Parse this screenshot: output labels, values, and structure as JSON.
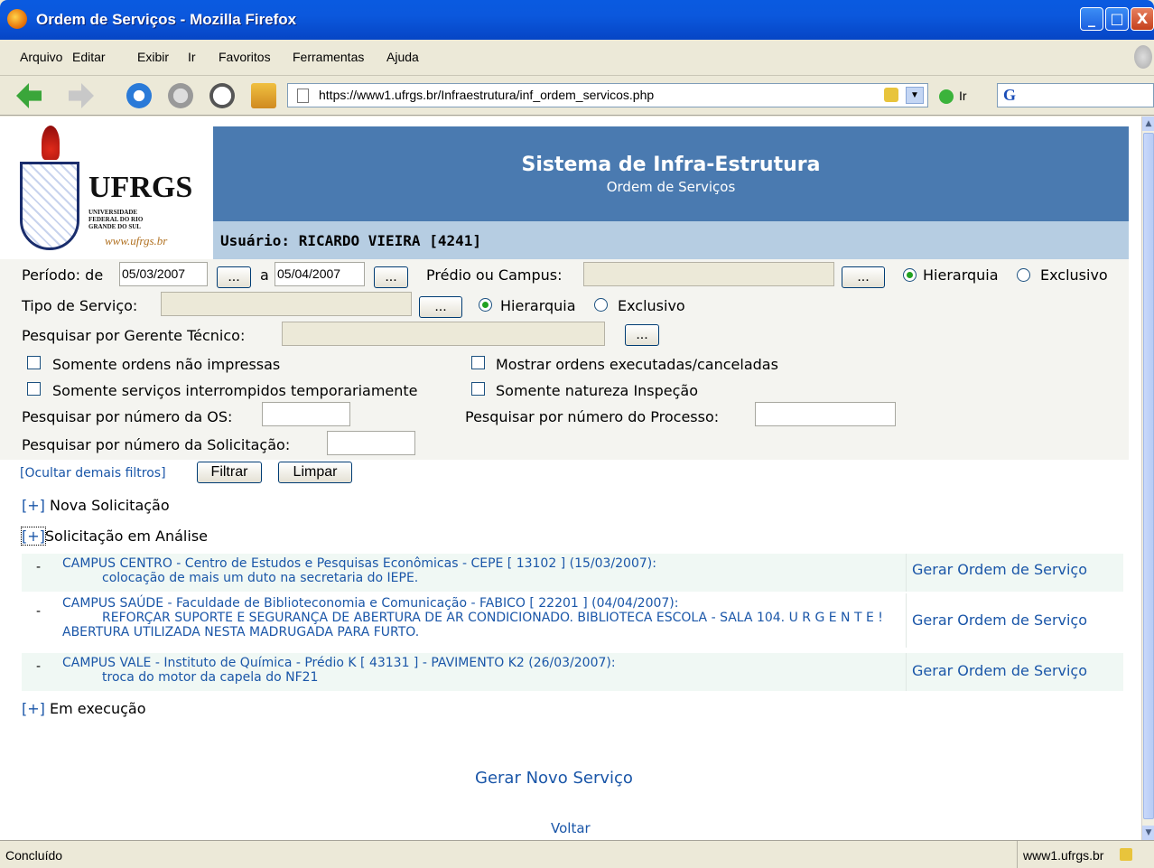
{
  "window": {
    "title": "Ordem de Serviços - Mozilla Firefox",
    "minimize_label": "_",
    "maximize_label": "□",
    "close_label": "X"
  },
  "menu": {
    "items": [
      "Arquivo",
      "Editar",
      "Exibir",
      "Ir",
      "Favoritos",
      "Ferramentas",
      "Ajuda"
    ]
  },
  "nav": {
    "url": "https://www1.ufrgs.br/Infraestrutura/inf_ordem_servicos.php",
    "go_label": "Ir",
    "search_engine_glyph": "G"
  },
  "header": {
    "logo_name": "UFRGS",
    "logo_subtitle": "UNIVERSIDADE FEDERAL DO RIO GRANDE DO SUL",
    "logo_web": "www.ufrgs.br",
    "title": "Sistema de Infra-Estrutura",
    "subtitle": "Ordem de Serviços",
    "user": "Usuário: RICARDO VIEIRA [4241]"
  },
  "filters": {
    "periodo_label": "Período: de",
    "periodo_from": "05/03/2007",
    "a_label": "a",
    "periodo_to": "05/04/2007",
    "picker_label": "...",
    "predio_label": "Prédio ou Campus:",
    "hierarquia_label": "Hierarquia",
    "exclusivo_label": "Exclusivo",
    "tipo_label": "Tipo de Serviço:",
    "gerente_label": "Pesquisar por Gerente Técnico:",
    "chk_nao_impressas": "Somente ordens não impressas",
    "chk_executadas": "Mostrar ordens executadas/canceladas",
    "chk_interrompidos": "Somente serviços interrompidos temporariamente",
    "chk_inspecao": "Somente natureza Inspeção",
    "os_label": "Pesquisar por número da OS:",
    "processo_label": "Pesquisar por número do Processo:",
    "solicitacao_label": "Pesquisar por número da Solicitação:",
    "ocultar_link": "[Ocultar demais filtros]",
    "filtrar_button": "Filtrar",
    "limpar_button": "Limpar"
  },
  "sections": {
    "toggle": "[+]",
    "nova": "Nova Solicitação",
    "analise": "Solicitação em Análise",
    "execucao": "Em execução"
  },
  "requests": [
    {
      "title": "CAMPUS CENTRO - Centro de Estudos e Pesquisas Econômicas - CEPE [ 13102 ] (15/03/2007):",
      "description": "colocação de mais um duto na secretaria do IEPE.",
      "action": "Gerar Ordem de Serviço"
    },
    {
      "title": "CAMPUS SAÚDE - Faculdade de Biblioteconomia e Comunicação - FABICO [ 22201 ] (04/04/2007):",
      "description": "REFORÇAR SUPORTE E SEGURANÇA DE ABERTURA DE AR CONDICIONADO. BIBLIOTECA ESCOLA - SALA 104. U R G E N T E ! ABERTURA UTILIZADA NESTA MADRUGADA PARA FURTO.",
      "action": "Gerar Ordem de Serviço"
    },
    {
      "title": "CAMPUS VALE - Instituto de Química - Prédio K [ 43131 ] - PAVIMENTO K2 (26/03/2007):",
      "description": "troca do motor da capela do NF21",
      "action": "Gerar Ordem de Serviço"
    }
  ],
  "footer": {
    "novo_servico": "Gerar Novo Serviço",
    "voltar": "Voltar"
  },
  "status": {
    "left": "Concluído",
    "right": "www1.ufrgs.br"
  },
  "colors": {
    "banner": "#4a7ab0",
    "userbar": "#b6cde2",
    "link": "#1a56a8",
    "titlebar": "#0b58dd"
  }
}
